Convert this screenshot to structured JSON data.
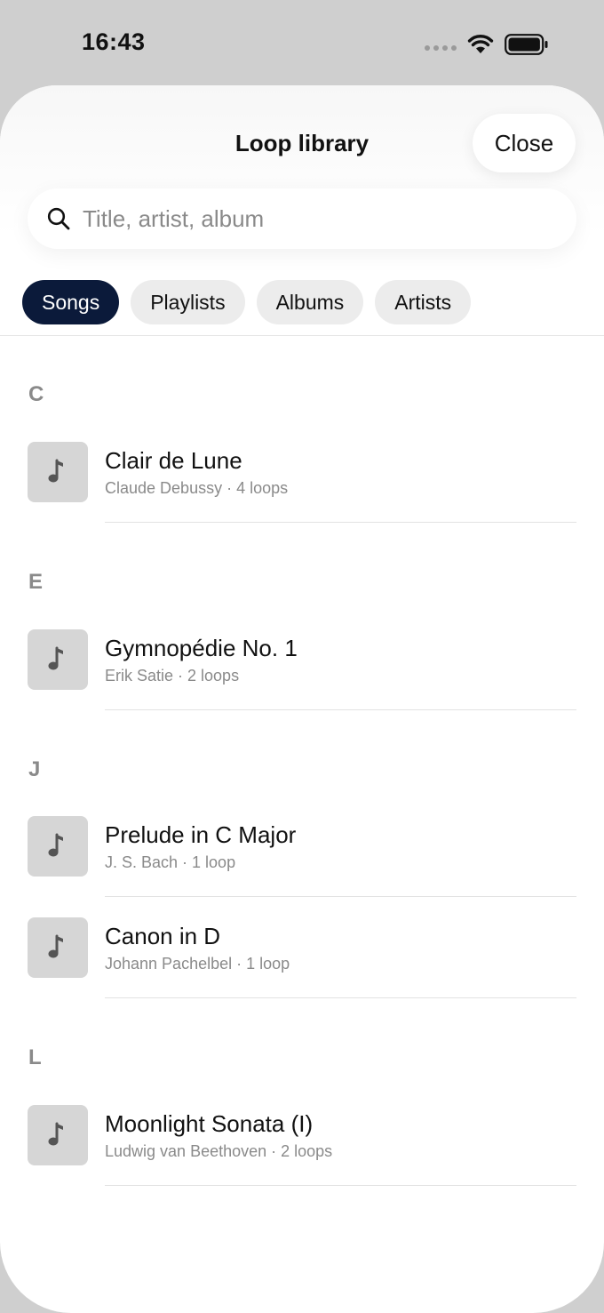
{
  "status_bar": {
    "time": "16:43"
  },
  "sheet": {
    "title": "Loop library",
    "close_label": "Close",
    "search": {
      "placeholder": "Title, artist, album",
      "value": ""
    },
    "segments": [
      {
        "label": "Songs",
        "selected": true
      },
      {
        "label": "Playlists",
        "selected": false
      },
      {
        "label": "Albums",
        "selected": false
      },
      {
        "label": "Artists",
        "selected": false
      }
    ],
    "sections": [
      {
        "letter": "C",
        "songs": [
          {
            "title": "Clair de Lune",
            "meta": "Claude Debussy · 4 loops"
          }
        ]
      },
      {
        "letter": "E",
        "songs": [
          {
            "title": "Gymnopédie No. 1",
            "meta": "Erik Satie · 2 loops"
          }
        ]
      },
      {
        "letter": "J",
        "songs": [
          {
            "title": "Prelude in C Major",
            "meta": "J. S. Bach · 1 loop"
          },
          {
            "title": "Canon in D",
            "meta": "Johann Pachelbel · 1 loop"
          }
        ]
      },
      {
        "letter": "L",
        "songs": [
          {
            "title": "Moonlight Sonata (I)",
            "meta": "Ludwig van Beethoven · 2 loops"
          }
        ]
      }
    ]
  },
  "colors": {
    "accent": "#0b1a3a",
    "sheet_background": "#ffffff",
    "screen_background": "#cfcfcf",
    "secondary_text": "#8a8a8a"
  },
  "icons": {
    "search": "magnifying-glass",
    "song_art": "music-note",
    "status": [
      "cellular-signal",
      "wifi",
      "battery"
    ]
  }
}
